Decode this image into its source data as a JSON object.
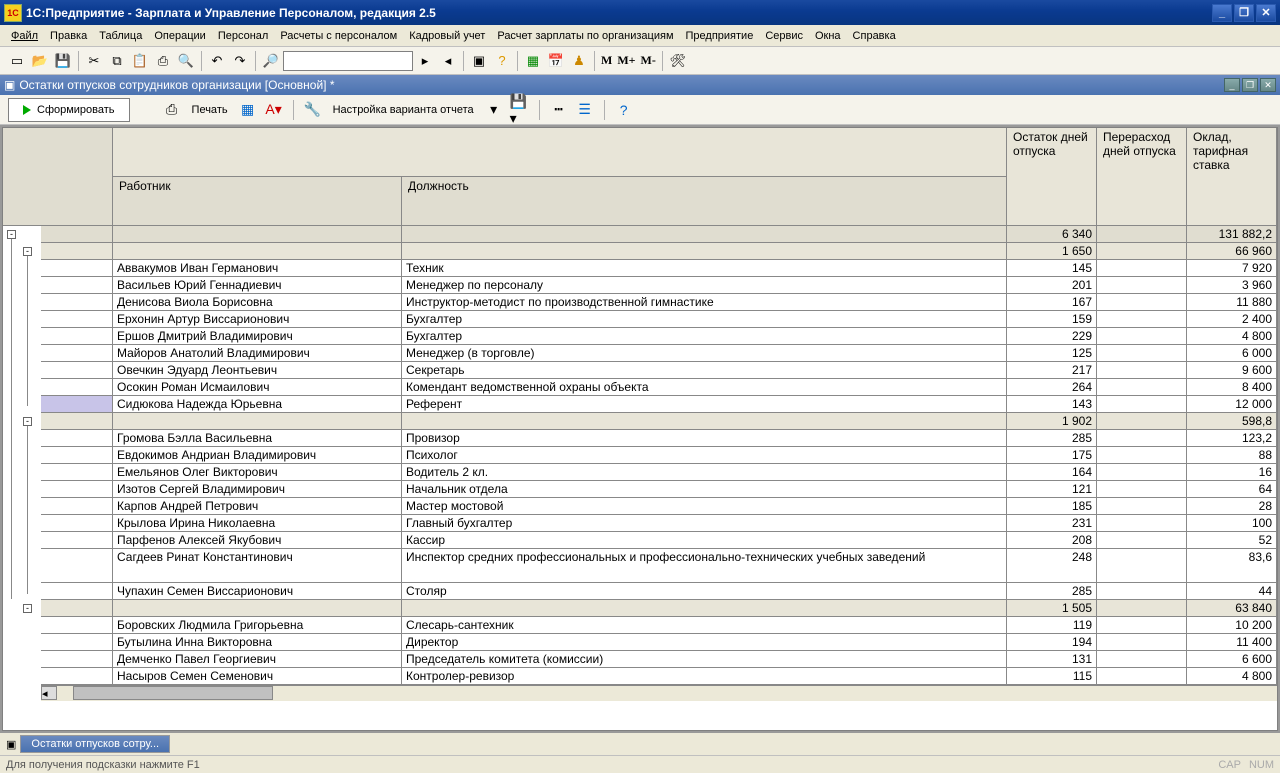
{
  "title": "1С:Предприятие - Зарплата и Управление Персоналом, редакция 2.5",
  "app_icon": "1C",
  "menu": [
    "Файл",
    "Правка",
    "Таблица",
    "Операции",
    "Персонал",
    "Расчеты с персоналом",
    "Кадровый учет",
    "Расчет зарплаты по организациям",
    "Предприятие",
    "Сервис",
    "Окна",
    "Справка"
  ],
  "inner_title": "Остатки отпусков сотрудников организации [Основной] *",
  "report_toolbar": {
    "form": "Сформировать",
    "print": "Печать",
    "settings": "Настройка варианта отчета"
  },
  "mlabels": {
    "m": "M",
    "mp": "M+",
    "mm": "M-"
  },
  "headers": {
    "worker": "Работник",
    "position": "Должность",
    "c1": "Остаток дней отпуска",
    "c2": "Перерасход дней отпуска",
    "c3": "Оклад, тарифная ставка"
  },
  "grand_total": {
    "ostat": "6 340",
    "salary": "131 882,2"
  },
  "group1": {
    "ostat": "1 650",
    "salary": "66 960"
  },
  "group1_rows": [
    {
      "w": "Аввакумов Иван Германович",
      "p": "Техник",
      "o": "145",
      "s": "7 920",
      "sel": false
    },
    {
      "w": "Васильев Юрий Геннадиевич",
      "p": "Менеджер по персоналу",
      "o": "201",
      "s": "3 960",
      "sel": false
    },
    {
      "w": "Денисова Виола Борисовна",
      "p": "Инструктор-методист по производственной гимнастике",
      "o": "167",
      "s": "11 880",
      "sel": false
    },
    {
      "w": "Ерхонин Артур Виссарионович",
      "p": "Бухгалтер",
      "o": "159",
      "s": "2 400",
      "sel": false
    },
    {
      "w": "Ершов Дмитрий Владимирович",
      "p": "Бухгалтер",
      "o": "229",
      "s": "4 800",
      "sel": false
    },
    {
      "w": "Майоров Анатолий Владимирович",
      "p": "Менеджер (в торговле)",
      "o": "125",
      "s": "6 000",
      "sel": false
    },
    {
      "w": "Овечкин Эдуард Леонтьевич",
      "p": "Секретарь",
      "o": "217",
      "s": "9 600",
      "sel": false
    },
    {
      "w": "Осокин Роман Исмаилович",
      "p": "Комендант ведомственной охраны объекта",
      "o": "264",
      "s": "8 400",
      "sel": false
    },
    {
      "w": "Сидюкова Надежда Юрьевна",
      "p": "Референт",
      "o": "143",
      "s": "12 000",
      "sel": true
    }
  ],
  "group2": {
    "ostat": "1 902",
    "salary": "598,8"
  },
  "group2_rows": [
    {
      "w": "Громова Бэлла Васильевна",
      "p": "Провизор",
      "o": "285",
      "s": "123,2"
    },
    {
      "w": "Евдокимов Андриан Владимирович",
      "p": "Психолог",
      "o": "175",
      "s": "88"
    },
    {
      "w": "Емельянов Олег Викторович",
      "p": "Водитель 2 кл.",
      "o": "164",
      "s": "16"
    },
    {
      "w": "Изотов Сергей Владимирович",
      "p": "Начальник отдела",
      "o": "121",
      "s": "64"
    },
    {
      "w": "Карпов Андрей Петрович",
      "p": "Мастер мостовой",
      "o": "185",
      "s": "28"
    },
    {
      "w": "Крылова Ирина Николаевна",
      "p": "Главный бухгалтер",
      "o": "231",
      "s": "100"
    },
    {
      "w": "Парфенов Алексей Якубович",
      "p": "Кассир",
      "o": "208",
      "s": "52"
    },
    {
      "w": "Сагдеев Ринат Константинович",
      "p": "Инспектор средних профессиональных и профессионально-технических учебных заведений",
      "o": "248",
      "s": "83,6",
      "multi": true
    },
    {
      "w": "Чупахин Семен Виссарионович",
      "p": "Столяр",
      "o": "285",
      "s": "44"
    }
  ],
  "group3": {
    "ostat": "1 505",
    "salary": "63 840"
  },
  "group3_rows": [
    {
      "w": "Боровских Людмила Григорьевна",
      "p": "Слесарь-сантехник",
      "o": "119",
      "s": "10 200"
    },
    {
      "w": "Бутылина Инна Викторовна",
      "p": "Директор",
      "o": "194",
      "s": "11 400"
    },
    {
      "w": "Демченко Павел Георгиевич",
      "p": "Председатель комитета (комиссии)",
      "o": "131",
      "s": "6 600"
    },
    {
      "w": "Насыров Семен Семенович",
      "p": "Контролер-ревизор",
      "o": "115",
      "s": "4 800"
    }
  ],
  "task_tab": "Остатки отпусков сотру...",
  "status": "Для получения подсказки нажмите F1",
  "cap": "CAP",
  "num": "NUM"
}
